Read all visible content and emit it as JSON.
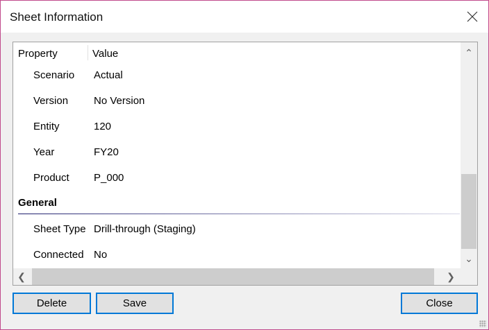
{
  "dialog": {
    "title": "Sheet Information"
  },
  "grid": {
    "columns": {
      "property": "Property",
      "value": "Value"
    },
    "rows": [
      {
        "key": "Scenario",
        "value": "Actual"
      },
      {
        "key": "Version",
        "value": "No Version"
      },
      {
        "key": "Entity",
        "value": "120"
      },
      {
        "key": "Year",
        "value": "FY20"
      },
      {
        "key": "Product",
        "value": "P_000"
      }
    ],
    "group": "General",
    "group_rows": [
      {
        "key": "Sheet Type",
        "value": "Drill-through (Staging)"
      },
      {
        "key": "Connected",
        "value": "No"
      }
    ]
  },
  "buttons": {
    "delete": "Delete",
    "save": "Save",
    "close": "Close"
  },
  "colors": {
    "accent": "#0078d7",
    "border": "#c04a8c"
  }
}
